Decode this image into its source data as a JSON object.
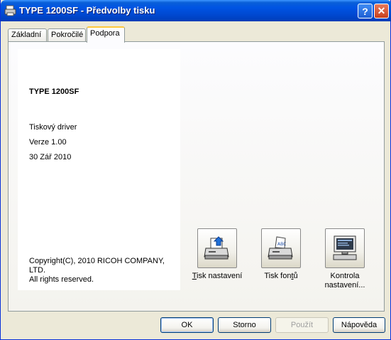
{
  "window": {
    "title": "TYPE 1200SF - Předvolby tisku",
    "help_button": "?",
    "close_button": "✕"
  },
  "tabs": [
    {
      "label": "Základní"
    },
    {
      "label": "Pokročilé"
    },
    {
      "label": "Podpora",
      "active": true
    }
  ],
  "info": {
    "model": "TYPE 1200SF",
    "driver": "Tiskový driver",
    "version": "Verze 1.00",
    "date": "30 Zář 2010",
    "copyright_line1": "Copyright(C), 2010 RICOH COMPANY, LTD.",
    "copyright_line2": "All rights reserved."
  },
  "tools": [
    {
      "label_access": "T",
      "label_rest": "isk nastavení",
      "icon": "printer-settings-icon"
    },
    {
      "label_pre": "Tisk fon",
      "label_access": "t",
      "label_rest": "ů",
      "icon": "printer-fonts-icon"
    },
    {
      "label_line1": "Kontrola",
      "label_line2": "nastavení...",
      "icon": "computer-monitor-icon"
    }
  ],
  "buttons": {
    "ok": "OK",
    "cancel": "Storno",
    "apply": "Použít",
    "help": "Nápověda"
  },
  "colors": {
    "titlebar": "#0054e3",
    "tab_highlight": "#ffc83c",
    "window_bg": "#ece9d8"
  }
}
